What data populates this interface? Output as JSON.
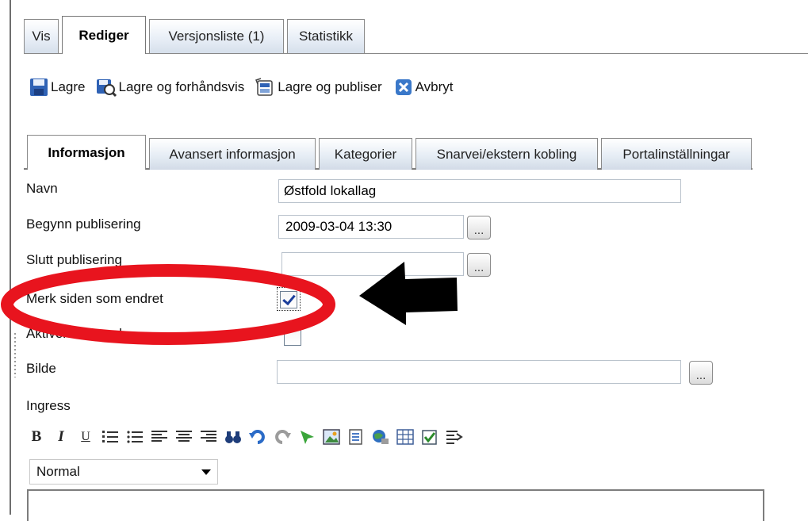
{
  "top_tabs": [
    {
      "label": "Vis"
    },
    {
      "label": "Rediger",
      "active": true
    },
    {
      "label": "Versjonsliste (1)"
    },
    {
      "label": "Statistikk"
    }
  ],
  "toolbar": {
    "save": "Lagre",
    "save_preview": "Lagre og forhåndsvis",
    "save_publish": "Lagre og publiser",
    "cancel": "Avbryt"
  },
  "form_tabs": [
    {
      "label": "Informasjon",
      "active": true
    },
    {
      "label": "Avansert informasjon"
    },
    {
      "label": "Kategorier"
    },
    {
      "label": "Snarvei/ekstern kobling"
    },
    {
      "label": "Portalinställningar"
    }
  ],
  "form": {
    "name_label": "Navn",
    "name_value": "Østfold lokallag",
    "start_label": "Begynn publisering",
    "start_value": "2009-03-04 13:30",
    "stop_label": "Slutt publisering",
    "stop_value": "",
    "mark_changed_label": "Merk siden som endret",
    "mark_changed_checked": true,
    "activate_label": "Aktiver som mal",
    "activate_checked": false,
    "image_label": "Bilde",
    "image_value": "",
    "intro_label": "Ingress",
    "picker_label": "...",
    "format_value": "Normal"
  },
  "rte_buttons": {
    "bold": "B",
    "italic": "I",
    "underline": "U"
  },
  "colors": {
    "annotation_ellipse": "#e8141e",
    "annotation_arrow": "#000000",
    "tab_border": "#8a8a8a"
  }
}
